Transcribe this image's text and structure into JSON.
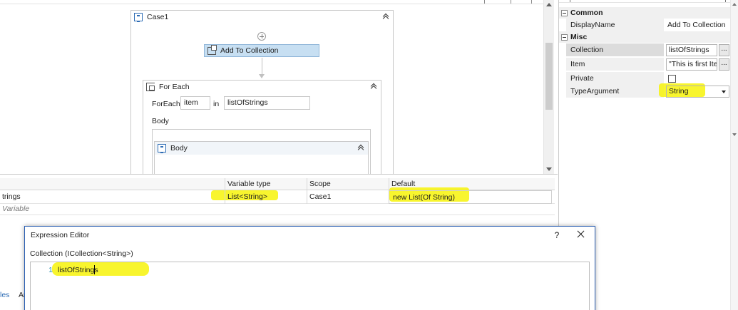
{
  "designer": {
    "case": {
      "title": "Case1"
    },
    "add_to_collection": {
      "label": "Add To Collection"
    },
    "for_each": {
      "title": "For Each",
      "foreach_label": "ForEach",
      "item_value": "item",
      "in_label": "in",
      "collection_value": "listOfStrings",
      "body_label": "Body",
      "inner_body_title": "Body"
    }
  },
  "variables": {
    "headers": {
      "name": "",
      "type": "Variable type",
      "scope": "Scope",
      "default": "Default"
    },
    "row": {
      "name": "trings",
      "type": "List<String>",
      "scope": "Case1",
      "default": "new List(Of String)"
    },
    "create_label": "Variable"
  },
  "properties": {
    "categories": {
      "common": "Common",
      "misc": "Misc"
    },
    "display_name": {
      "name": "DisplayName",
      "value": "Add To Collection"
    },
    "collection": {
      "name": "Collection",
      "value": "listOfStrings"
    },
    "item": {
      "name": "Item",
      "value": "\"This is first Iter"
    },
    "private": {
      "name": "Private"
    },
    "type_argument": {
      "name": "TypeArgument",
      "value": "String"
    },
    "ellipsis": "..."
  },
  "dialog": {
    "title": "Expression Editor",
    "help": "?",
    "subtitle": "Collection (ICollection<String>)",
    "line_number": "1",
    "code": "listOfStrings"
  },
  "bottom_tabs": {
    "first": "les",
    "second": "Ar"
  },
  "colors": {
    "highlight": "#f7f300",
    "selected_activity": "#c7dff2",
    "dialog_border": "#2b5fb3"
  }
}
